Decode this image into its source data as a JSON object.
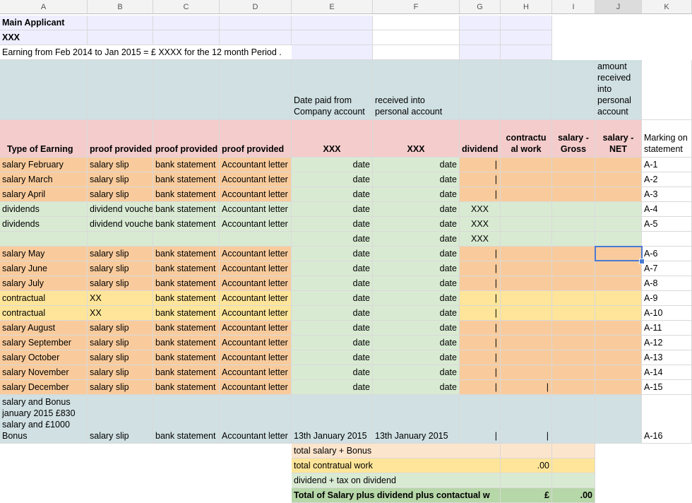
{
  "columns": [
    "A",
    "B",
    "C",
    "D",
    "E",
    "F",
    "G",
    "H",
    "I",
    "J",
    "K"
  ],
  "selected_column": "J",
  "colors": {
    "teal": "#d0e0e3",
    "pink": "#f4cccc",
    "orange": "#f9cb9c",
    "green": "#d9ead3",
    "yellow": "#ffe599",
    "lavender": "#eeeeff",
    "peach": "#fce5cd",
    "dark_green": "#b6d7a8",
    "selection": "#4a7bd4"
  },
  "header": {
    "main_applicant": "Main Applicant",
    "xxx": "XXX",
    "earning_note": "Earning from Feb 2014 to Jan 2015 = £ XXXX for the 12 month Period .",
    "date_paid": "Date paid from Company account",
    "received_into": "received into personal account",
    "amount_received": "amount received into personal account",
    "type_of_earning": "Type of Earning",
    "proof_provided": "proof provided",
    "proof_provided_c": "proof provided",
    "proof_provided_d": "proof provided",
    "xxx_e": "XXX",
    "xxx_f": "XXX",
    "dividend": "dividend",
    "contractual_work": "contractu al work",
    "salary_gross": "salary - Gross",
    "salary_net": "salary - NET",
    "marking": "Marking on statement"
  },
  "rows": [
    {
      "a": "salary February",
      "b": "salary slip",
      "c": "bank statement",
      "d": "Accountant letter",
      "e": "date",
      "f": "date",
      "g": "|",
      "h": "",
      "k": "A-1",
      "color": "orange"
    },
    {
      "a": "salary March",
      "b": "salary slip",
      "c": "bank statement",
      "d": "Accountant letter",
      "e": "date",
      "f": "date",
      "g": "|",
      "h": "",
      "k": "A-2",
      "color": "orange"
    },
    {
      "a": "salary April",
      "b": "salary slip",
      "c": "bank statement",
      "d": "Accountant letter",
      "e": "date",
      "f": "date",
      "g": "|",
      "h": "",
      "k": "A-3",
      "color": "orange"
    },
    {
      "a": "dividends",
      "b": "dividend vouche",
      "c": "bank statement",
      "d": "Accountant letter",
      "e": "date",
      "f": "date",
      "g": "XXX",
      "h": "",
      "k": "A-4",
      "color": "green"
    },
    {
      "a": "dividends",
      "b": "dividend vouche",
      "c": "bank statement",
      "d": "Accountant letter",
      "e": "date",
      "f": "date",
      "g": "XXX",
      "h": "",
      "k": "A-5",
      "color": "green"
    },
    {
      "a": "",
      "b": "",
      "c": "",
      "d": "",
      "e": "date",
      "f": "date",
      "g": "XXX",
      "h": "",
      "k": "",
      "color": "green"
    },
    {
      "a": "salary May",
      "b": "salary slip",
      "c": "bank statement",
      "d": "Accountant letter",
      "e": "date",
      "f": "date",
      "g": "|",
      "h": "",
      "k": "A-6",
      "color": "orange"
    },
    {
      "a": "salary June",
      "b": "salary slip",
      "c": "bank statement",
      "d": "Accountant letter",
      "e": "date",
      "f": "date",
      "g": "|",
      "h": "",
      "k": "A-7",
      "color": "orange"
    },
    {
      "a": "salary July",
      "b": "salary slip",
      "c": "bank statement",
      "d": "Accountant letter",
      "e": "date",
      "f": "date",
      "g": "|",
      "h": "",
      "k": "A-8",
      "color": "orange"
    },
    {
      "a": "contractual",
      "b": "XX",
      "c": "bank statement",
      "d": "Accountant letter",
      "e": "date",
      "f": "date",
      "g": "|",
      "h": "",
      "k": "A-9",
      "color": "yellow"
    },
    {
      "a": "contractual",
      "b": "XX",
      "c": "bank statement",
      "d": "Accountant letter",
      "e": "date",
      "f": "date",
      "g": "|",
      "h": "",
      "k": "A-10",
      "color": "yellow"
    },
    {
      "a": "salary August",
      "b": "salary slip",
      "c": "bank statement",
      "d": "Accountant letter",
      "e": "date",
      "f": "date",
      "g": "|",
      "h": "",
      "k": "A-11",
      "color": "orange"
    },
    {
      "a": "salary September",
      "b": "salary slip",
      "c": "bank statement",
      "d": "Accountant letter",
      "e": "date",
      "f": "date",
      "g": "|",
      "h": "",
      "k": "A-12",
      "color": "orange"
    },
    {
      "a": "salary October",
      "b": "salary slip",
      "c": "bank statement",
      "d": "Accountant letter",
      "e": "date",
      "f": "date",
      "g": "|",
      "h": "",
      "k": "A-13",
      "color": "orange"
    },
    {
      "a": "salary November",
      "b": "salary slip",
      "c": "bank statement",
      "d": "Accountant letter",
      "e": "date",
      "f": "date",
      "g": "|",
      "h": "",
      "k": "A-14",
      "color": "orange"
    },
    {
      "a": "salary December",
      "b": "salary slip",
      "c": "bank statement",
      "d": "Accountant letter",
      "e": "date",
      "f": "date",
      "g": "|",
      "h": "|",
      "k": "A-15",
      "color": "orange"
    }
  ],
  "bonus_row": {
    "a": "salary and Bonus january 2015 £830 salary and £1000 Bonus",
    "b": "salary slip",
    "c": "bank statement",
    "d": "Accountant letter",
    "e": "13th January 2015",
    "f": "13th January 2015",
    "g": "|",
    "h": "|",
    "k": "A-16"
  },
  "totals": {
    "salary_bonus": "total salary + Bonus",
    "contractual": "total contratual work",
    "contractual_value": ".00",
    "dividend": "dividend + tax on dividend",
    "grand": "Total of Salary plus dividend plus contactual w",
    "grand_currency": "£",
    "grand_value": ".00"
  }
}
